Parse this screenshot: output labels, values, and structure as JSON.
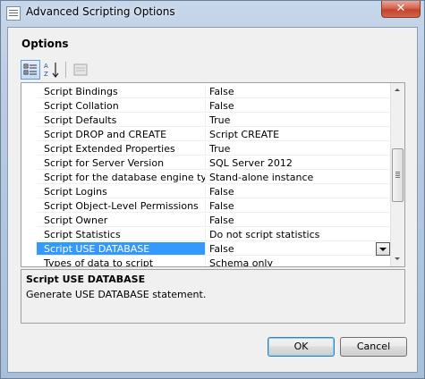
{
  "window": {
    "title": "Advanced Scripting Options",
    "close_label": "✕"
  },
  "options": {
    "heading": "Options"
  },
  "toolbar": {
    "buttons": [
      {
        "icon": "categorized-icon",
        "active": true
      },
      {
        "icon": "alphabetical-sort-icon",
        "active": false
      },
      {
        "icon": "property-pages-icon",
        "active": false
      }
    ]
  },
  "grid": {
    "rows": [
      {
        "name": "Script Bindings",
        "value": "False"
      },
      {
        "name": "Script Collation",
        "value": "False"
      },
      {
        "name": "Script Defaults",
        "value": "True"
      },
      {
        "name": "Script DROP and CREATE",
        "value": "Script CREATE"
      },
      {
        "name": "Script Extended Properties",
        "value": "True"
      },
      {
        "name": "Script for Server Version",
        "value": "SQL Server 2012"
      },
      {
        "name": "Script for the database engine type",
        "value": "Stand-alone instance"
      },
      {
        "name": "Script Logins",
        "value": "False"
      },
      {
        "name": "Script Object-Level Permissions",
        "value": "False"
      },
      {
        "name": "Script Owner",
        "value": "False"
      },
      {
        "name": "Script Statistics",
        "value": "Do not script statistics"
      },
      {
        "name": "Script USE DATABASE",
        "value": "False",
        "selected": true
      },
      {
        "name": "Types of data to script",
        "value": "Schema only"
      }
    ],
    "selected_index": 11
  },
  "description": {
    "title": "Script USE DATABASE",
    "text": "Generate USE DATABASE statement."
  },
  "buttons": {
    "ok": "OK",
    "cancel": "Cancel"
  },
  "colors": {
    "selection": "#3399ff",
    "close_button": "#c2452d"
  }
}
